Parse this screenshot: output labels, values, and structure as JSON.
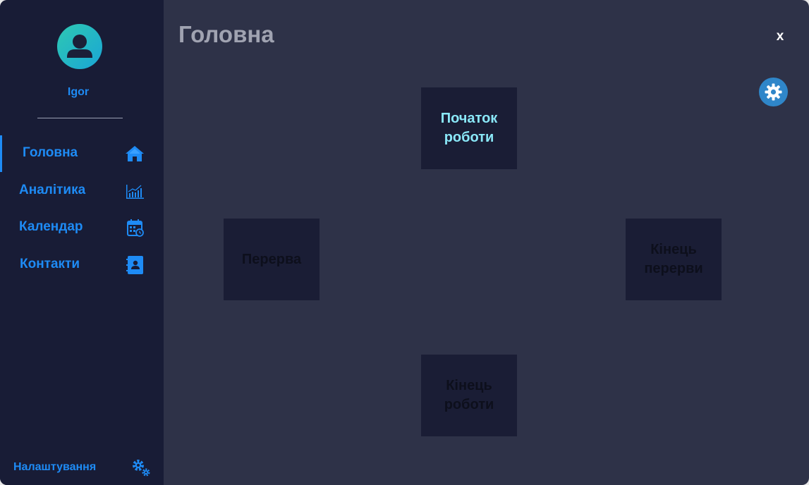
{
  "user": {
    "name": "Igor"
  },
  "nav": {
    "items": [
      {
        "label": "Головна",
        "icon": "home-icon"
      },
      {
        "label": "Аналітика",
        "icon": "analytics-chart-icon"
      },
      {
        "label": "Календар",
        "icon": "calendar-icon"
      },
      {
        "label": "Контакти",
        "icon": "contacts-book-icon"
      }
    ],
    "active": "Головна"
  },
  "settings": {
    "label": "Налаштування",
    "icon": "gears-icon"
  },
  "page": {
    "title": "Головна"
  },
  "header": {
    "close_label": "x",
    "settings_icon": "gear-icon"
  },
  "tiles": {
    "start_work": "Початок роботи",
    "break": "Перерва",
    "end_break": "Кінець перерви",
    "end_work": "Кінець роботи"
  },
  "colors": {
    "accent": "#1e8bf5",
    "sidebar_bg": "#181c36",
    "main_bg": "#2e3248",
    "tile_bg": "#1a1d35",
    "highlight_text": "#8ae8f8"
  }
}
